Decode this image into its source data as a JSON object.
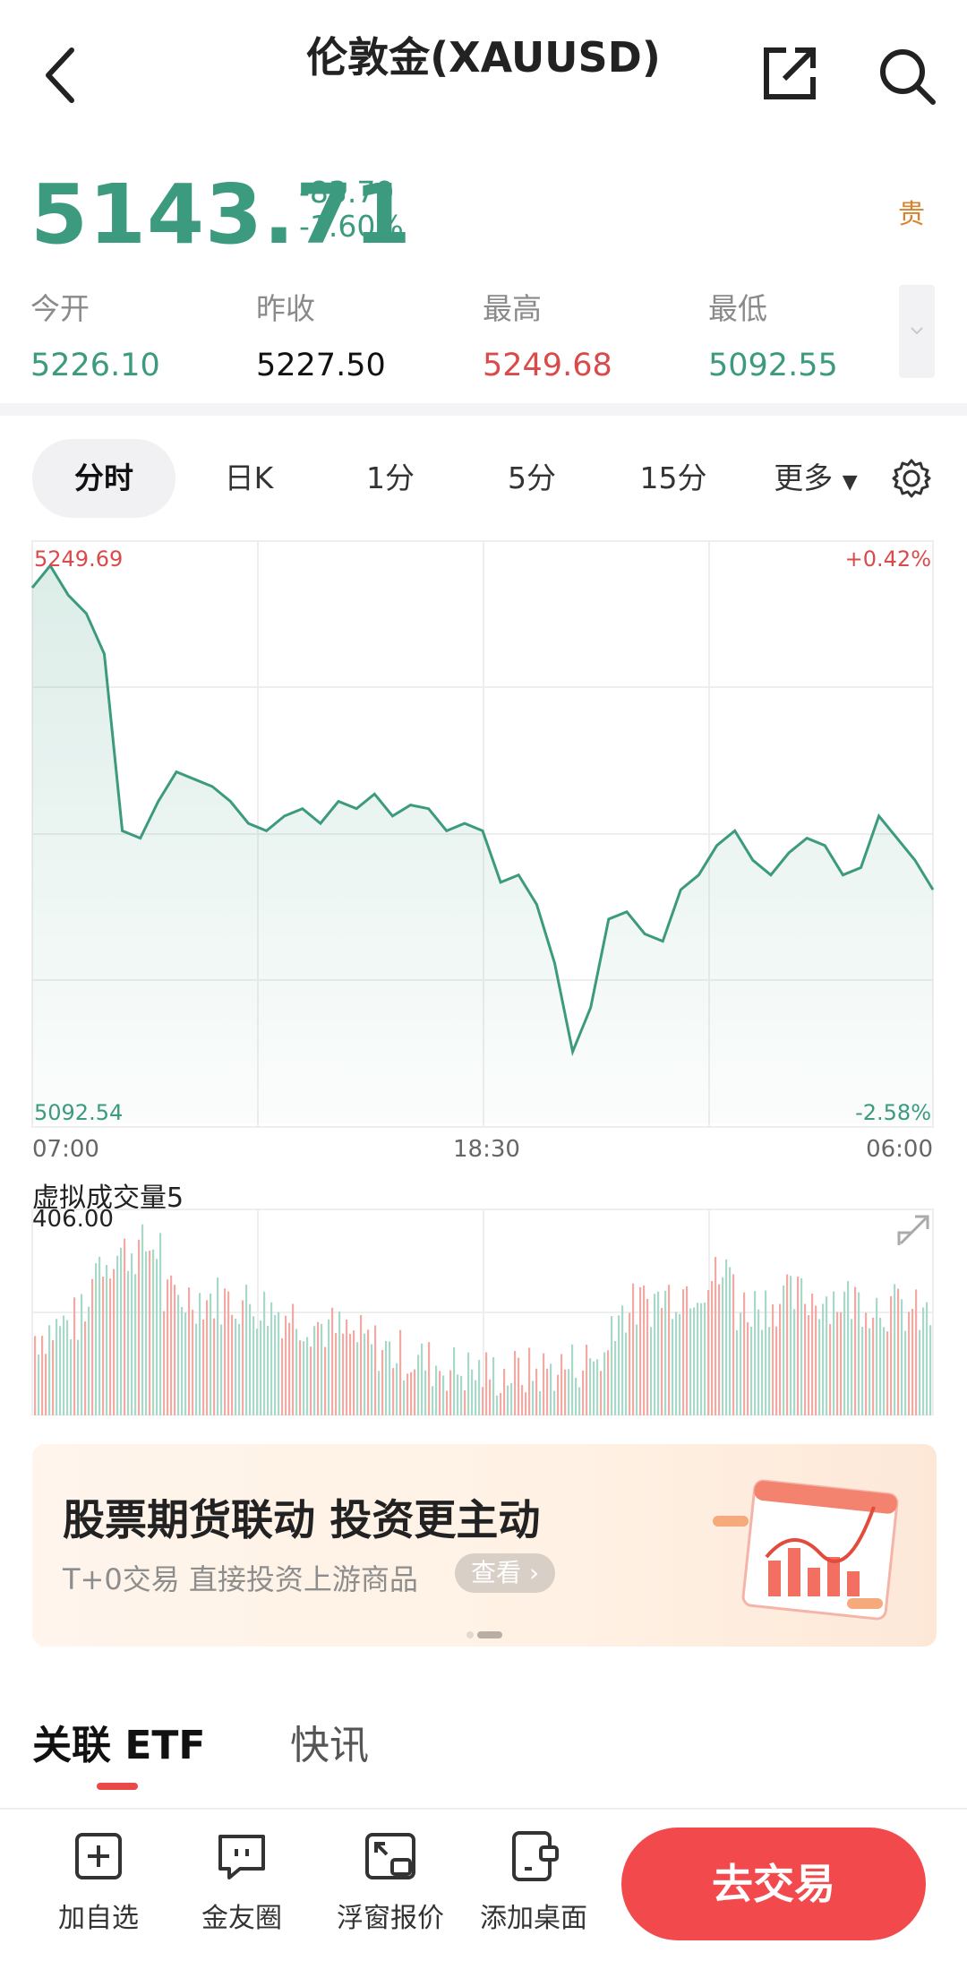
{
  "header": {
    "title": "伦敦金(XAUUSD)",
    "back_icon": "chevron-left-icon",
    "share_icon": "share-icon",
    "search_icon": "search-icon"
  },
  "quote": {
    "last": "5143.71",
    "change": "-83.79",
    "change_pct": "-1.60%",
    "badge": "贵",
    "colors": {
      "down": "#3c9a7e",
      "up": "#d94b4b",
      "badge": "#d9822b"
    }
  },
  "stats": [
    {
      "label": "今开",
      "value": "5226.10",
      "color": "#3c9a7e"
    },
    {
      "label": "昨收",
      "value": "5227.50",
      "color": "#111111"
    },
    {
      "label": "最高",
      "value": "5249.68",
      "color": "#d94b4b"
    },
    {
      "label": "最低",
      "value": "5092.55",
      "color": "#3c9a7e"
    }
  ],
  "chart_tabs": [
    "分时",
    "日K",
    "1分",
    "5分",
    "15分",
    "更多"
  ],
  "chart_tabs_active": "分时",
  "chart_data": [
    {
      "type": "line",
      "title": "",
      "y_top_label": "5249.69",
      "y_bottom_label": "5092.54",
      "pct_top_label": "+0.42%",
      "pct_bottom_label": "-2.58%",
      "x_tick_labels": [
        "07:00",
        "18:30",
        "06:00"
      ],
      "ylim": [
        5092.54,
        5249.69
      ],
      "x": [
        0,
        2,
        4,
        6,
        8,
        10,
        12,
        14,
        16,
        18,
        20,
        22,
        24,
        26,
        28,
        30,
        32,
        34,
        36,
        38,
        40,
        42,
        44,
        46,
        48,
        50,
        52,
        54,
        56,
        58,
        60,
        62,
        64,
        66,
        68,
        70,
        72,
        74,
        76,
        78,
        80,
        82,
        84,
        86,
        88,
        90,
        92,
        94,
        96,
        98,
        100
      ],
      "values": [
        5238,
        5244,
        5236,
        5231,
        5220,
        5172,
        5170,
        5180,
        5188,
        5186,
        5184,
        5180,
        5174,
        5172,
        5176,
        5178,
        5174,
        5180,
        5178,
        5182,
        5176,
        5179,
        5178,
        5172,
        5174,
        5172,
        5158,
        5160,
        5152,
        5136,
        5112,
        5124,
        5148,
        5150,
        5144,
        5142,
        5156,
        5160,
        5168,
        5172,
        5164,
        5160,
        5166,
        5170,
        5168,
        5160,
        5162,
        5176,
        5170,
        5164,
        5156
      ],
      "color": "#3c9a7e"
    },
    {
      "type": "bar",
      "title": "虚拟成交量5",
      "max_label": "406.00",
      "colors": {
        "up": "#f1a9a4",
        "down": "#a8d8c8"
      }
    }
  ],
  "banner": {
    "title": "股票期货联动 投资更主动",
    "subtitle": "T+0交易 直接投资上游商品",
    "cta": "查看"
  },
  "section_tabs": {
    "active": "关联 ETF",
    "inactive": "快讯"
  },
  "toolbar": {
    "items": [
      {
        "label": "加自选",
        "icon": "add-watchlist-icon"
      },
      {
        "label": "金友圈",
        "icon": "chat-icon"
      },
      {
        "label": "浮窗报价",
        "icon": "float-window-icon"
      },
      {
        "label": "添加桌面",
        "icon": "add-desktop-icon"
      }
    ],
    "trade_label": "去交易"
  }
}
